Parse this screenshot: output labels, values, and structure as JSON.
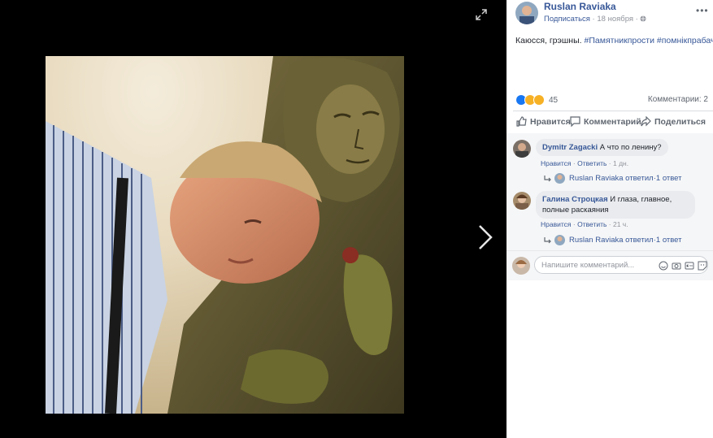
{
  "post": {
    "author": "Ruslan Raviaka",
    "subscribe": "Подписаться",
    "date": "18 ноября",
    "text": "Каюсся, грэшны.",
    "hashtags": "#Памятникпрости #помнiкпрабач",
    "reaction_count": "45",
    "comments_label": "Комментарии: 2"
  },
  "actions": {
    "like": "Нравится",
    "comment": "Комментарий",
    "share": "Поделиться"
  },
  "comments": [
    {
      "name": "Dymitr Zagacki",
      "text": "А что по ленину?",
      "like": "Нравится",
      "reply": "Ответить",
      "time": "1 дн.",
      "reply_author": "Ruslan Raviaka ответил",
      "reply_count": "1 ответ"
    },
    {
      "name": "Галина Строцкая",
      "text": "И глаза, главное, полные раскаяния",
      "like": "Нравится",
      "reply": "Ответить",
      "time": "21 ч.",
      "reply_author": "Ruslan Raviaka ответил",
      "reply_count": "1 ответ"
    }
  ],
  "composer": {
    "placeholder": "Напишите комментарий..."
  },
  "icons": {
    "expand": "expand-icon",
    "next": "chevron-right-icon",
    "more": "more-options-icon",
    "globe": "globe-icon",
    "like": "thumbs-up-icon",
    "comment": "comment-bubble-icon",
    "share": "share-arrow-icon"
  },
  "colors": {
    "link": "#385898",
    "viewer_bg": "#000000",
    "like_blue": "#1877f2",
    "haha_yellow": "#f7b125"
  },
  "separators": {
    "dot": " · "
  }
}
